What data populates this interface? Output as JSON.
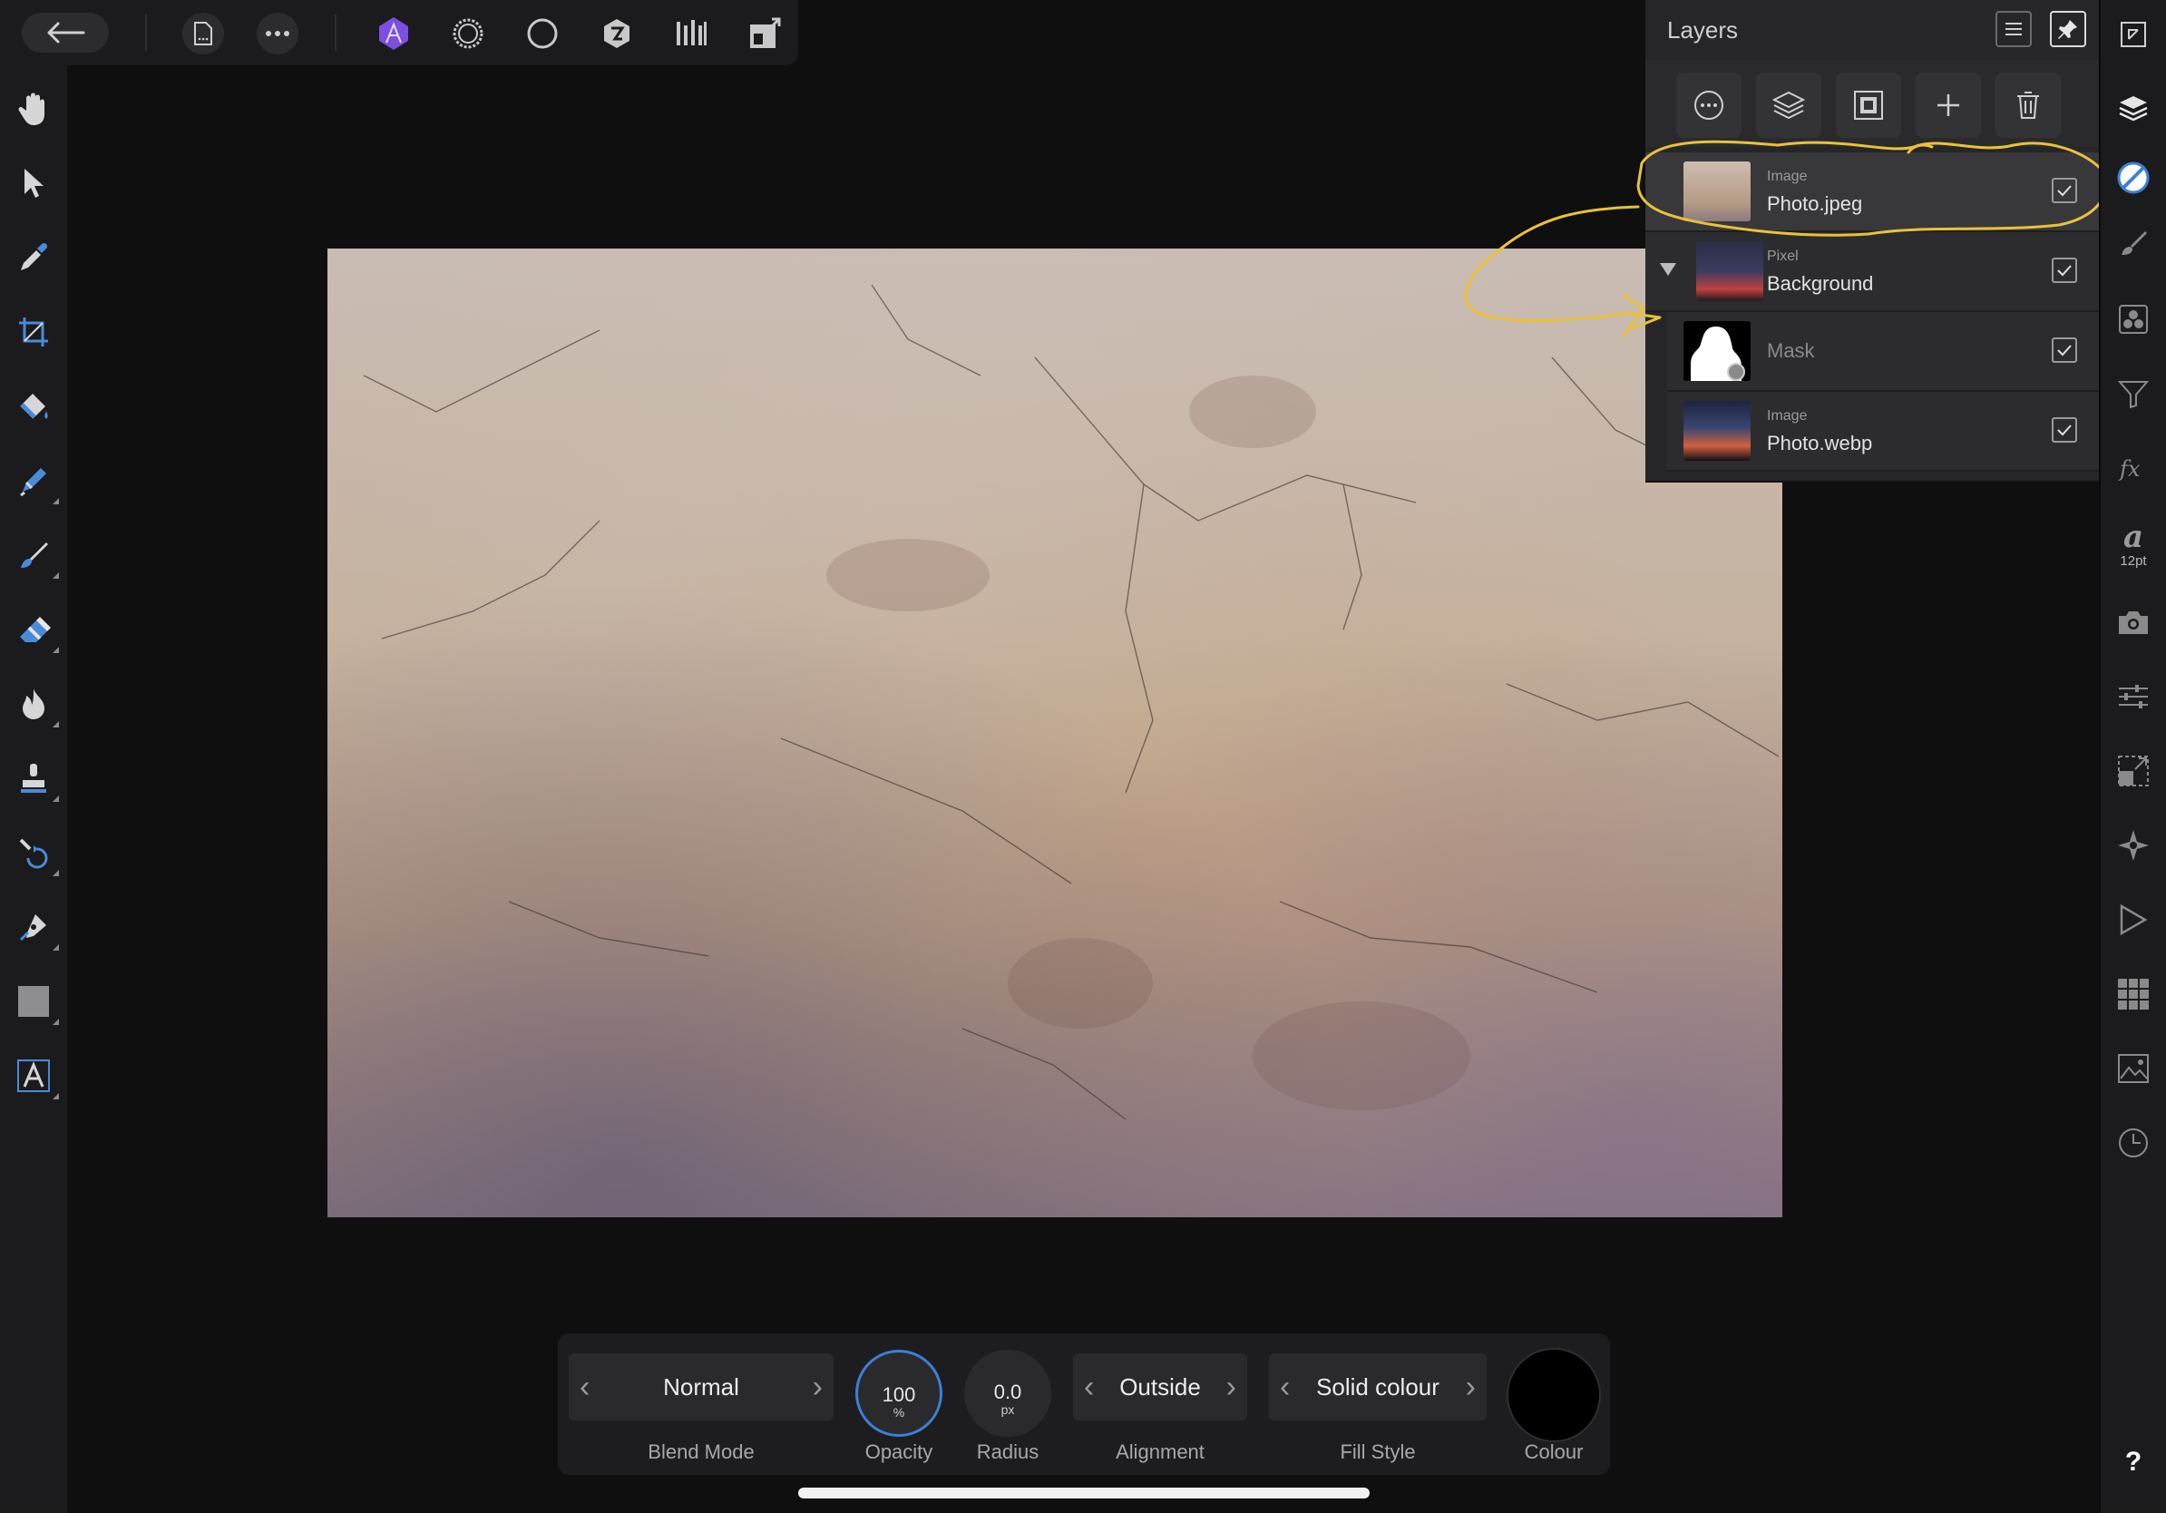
{
  "layers_panel": {
    "title": "Layers",
    "layers": [
      {
        "type": "Image",
        "name": "Photo.jpeg",
        "visible": true
      },
      {
        "type": "Pixel",
        "name": "Background",
        "visible": true
      },
      {
        "type": "",
        "name": "Mask",
        "visible": true
      },
      {
        "type": "Image",
        "name": "Photo.webp",
        "visible": true
      }
    ]
  },
  "right_toolbar": {
    "font_size_label": "12pt",
    "help_label": "?"
  },
  "context_toolbar": {
    "blend_mode": {
      "value": "Normal",
      "label": "Blend Mode"
    },
    "opacity": {
      "value": "100",
      "unit": "%",
      "label": "Opacity"
    },
    "radius": {
      "value": "0.0",
      "unit": "px",
      "label": "Radius"
    },
    "alignment": {
      "value": "Outside",
      "label": "Alignment"
    },
    "fill_style": {
      "value": "Solid colour",
      "label": "Fill Style"
    },
    "colour": {
      "label": "Colour",
      "color": "#000000"
    }
  },
  "colors": {
    "accent": "#7b4fe0",
    "annotation": "#e8c23a",
    "selection_ring": "#3d7fd6"
  }
}
